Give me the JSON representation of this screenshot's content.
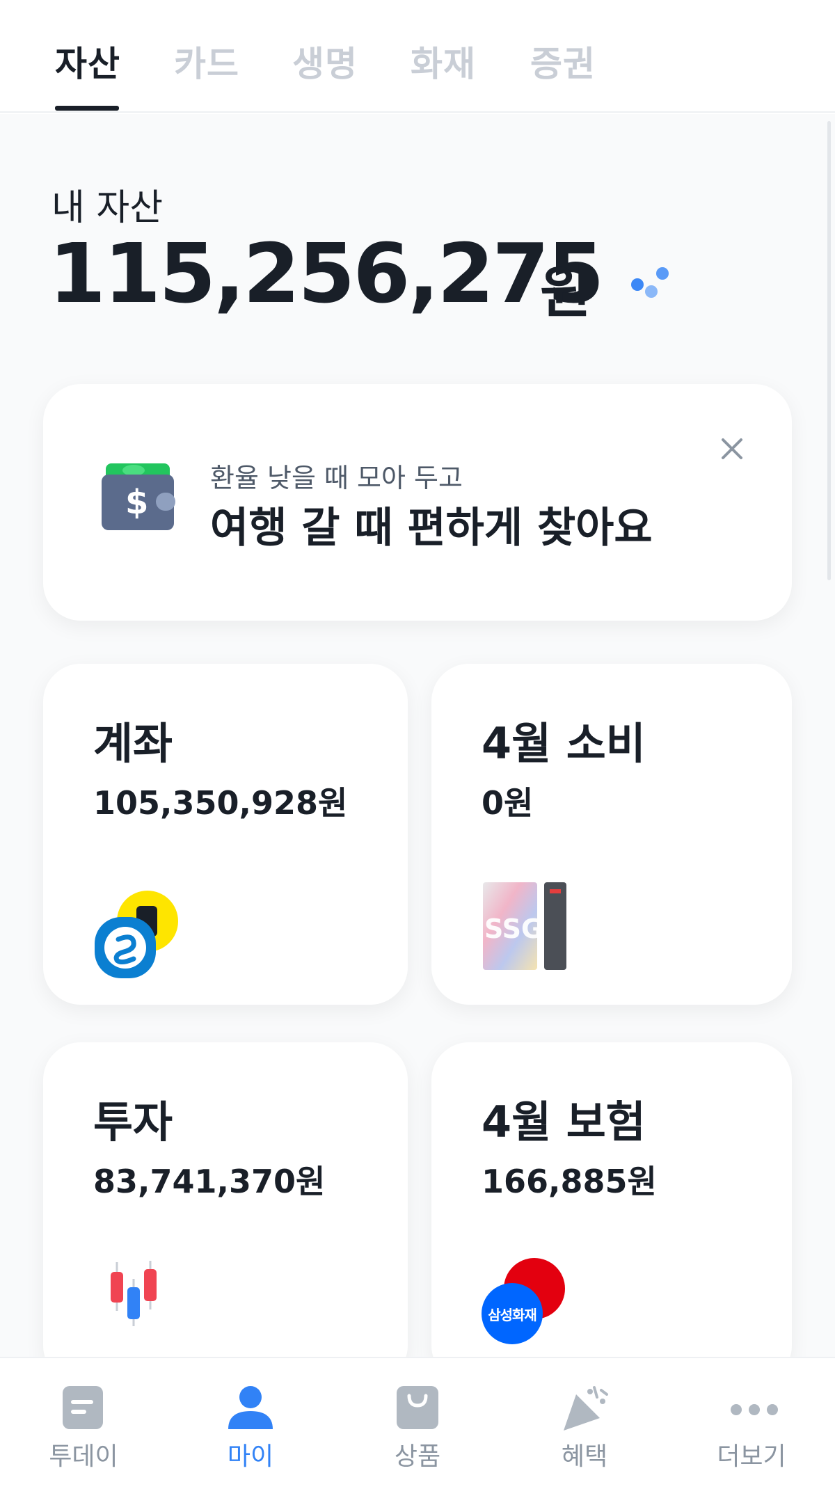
{
  "tabs": [
    {
      "label": "자산",
      "active": true
    },
    {
      "label": "카드",
      "active": false
    },
    {
      "label": "생명",
      "active": false
    },
    {
      "label": "화재",
      "active": false
    },
    {
      "label": "증권",
      "active": false
    }
  ],
  "summary": {
    "label": "내 자산",
    "amount": "115,256,275",
    "unit": "원"
  },
  "promo": {
    "subtitle": "환율 낮을 때 모아 두고",
    "title": "여행 갈 때 편하게 찾아요",
    "icon": "wallet-dollar-icon"
  },
  "cards": {
    "account": {
      "title": "계좌",
      "value": "105,350,928원",
      "icon": "bank-logos-icon"
    },
    "spending": {
      "title": "4월 소비",
      "value": "0원",
      "icon": "ssg-card-icon"
    },
    "invest": {
      "title": "투자",
      "value": "83,741,370원",
      "icon": "candlestick-icon"
    },
    "insurance": {
      "title": "4월 보험",
      "value": "166,885원",
      "icon": "insurer-logos-icon",
      "badge": "삼성화재"
    }
  },
  "bottom_nav": [
    {
      "label": "투데이",
      "active": false
    },
    {
      "label": "마이",
      "active": true
    },
    {
      "label": "상품",
      "active": false
    },
    {
      "label": "혜택",
      "active": false
    },
    {
      "label": "더보기",
      "active": false
    }
  ],
  "colors": {
    "accent": "#3182f6",
    "text": "#191f28",
    "muted": "#c9ced6"
  }
}
